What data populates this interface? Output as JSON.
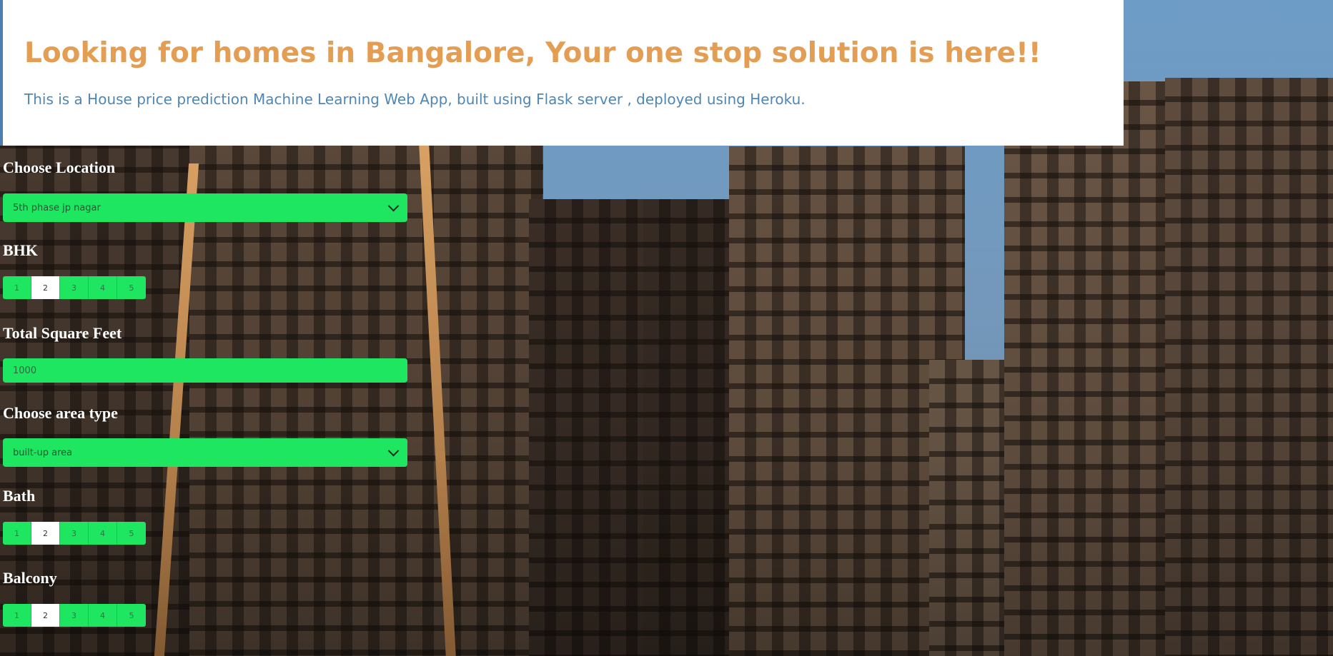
{
  "header": {
    "title": "Looking for homes in Bangalore, Your one stop solution is here!!",
    "subtitle": "This is a House price prediction Machine Learning Web App, built using Flask server , deployed using Heroku."
  },
  "form": {
    "location": {
      "label": "Choose Location",
      "value": "5th phase jp nagar"
    },
    "bhk": {
      "label": "BHK",
      "options": [
        "1",
        "2",
        "3",
        "4",
        "5"
      ],
      "selected": "2"
    },
    "sqft": {
      "label": "Total Square Feet",
      "value": "1000"
    },
    "area_type": {
      "label": "Choose area type",
      "value": "built-up area"
    },
    "bath": {
      "label": "Bath",
      "options": [
        "1",
        "2",
        "3",
        "4",
        "5"
      ],
      "selected": "2"
    },
    "balcony": {
      "label": "Balcony",
      "options": [
        "1",
        "2",
        "3",
        "4",
        "5"
      ],
      "selected": "2"
    }
  },
  "colors": {
    "title": "#e39e54",
    "subtitle": "#4e87b5",
    "control_green": "#1ee660",
    "label_white": "#ffffff"
  }
}
